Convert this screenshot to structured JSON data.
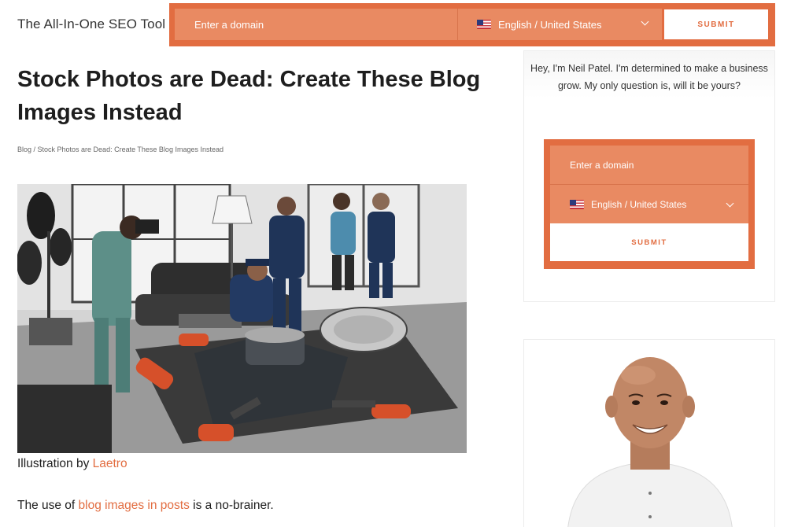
{
  "header": {
    "brand": "The All-In-One SEO Tool",
    "domain_placeholder": "Enter a domain",
    "language": "English / United States",
    "submit_label": "SUBMIT"
  },
  "article": {
    "title": "Stock Photos are Dead: Create These Blog Images Instead",
    "breadcrumb": "Blog / Stock Photos are Dead: Create These Blog Images Instead",
    "caption_prefix": "Illustration by ",
    "caption_link": "Laetro",
    "intro_prefix": "The use of ",
    "intro_link": "blog images in posts",
    "intro_suffix": " is a no-brainer."
  },
  "sidebar": {
    "intro": "Hey, I'm Neil Patel. I'm determined to make a business grow. My only question is, will it be yours?",
    "domain_placeholder": "Enter a domain",
    "language": "English / United States",
    "submit_label": "SUBMIT"
  },
  "icons": {
    "flag": "us-flag-icon",
    "dropdown": "chevron-down-icon"
  },
  "colors": {
    "accent": "#e26d41",
    "accent_light": "#e98a62",
    "text": "#1e1e1e"
  }
}
